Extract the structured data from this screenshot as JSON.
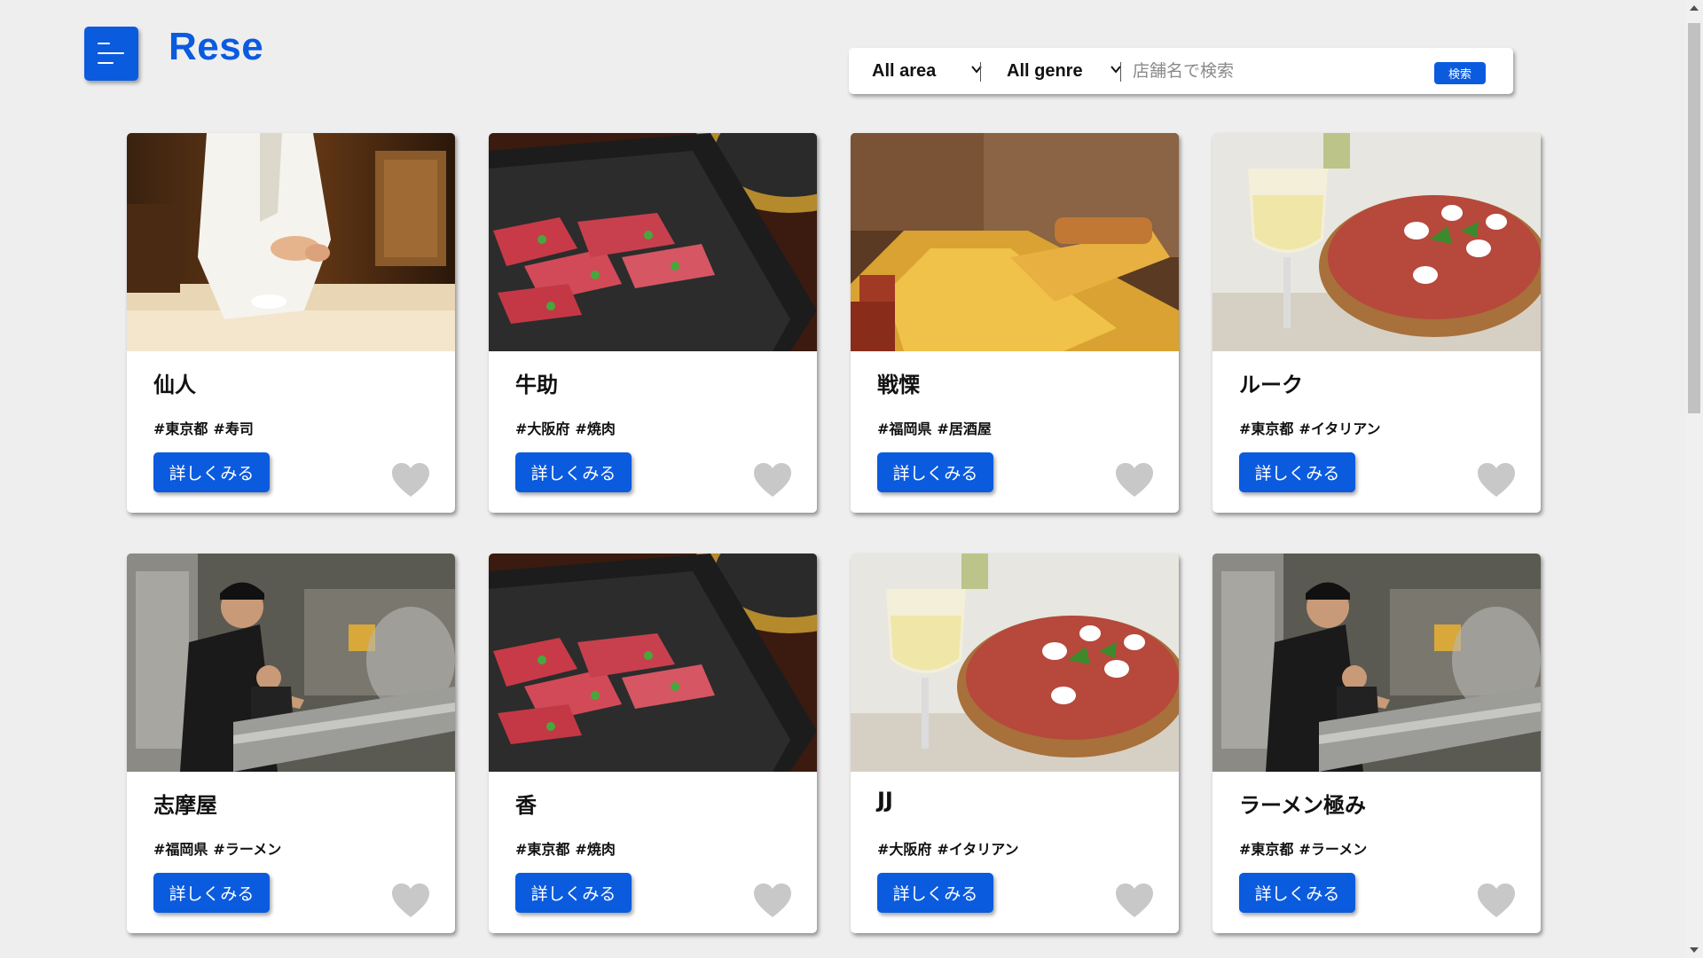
{
  "app": {
    "logo": "Rese",
    "brand_color": "#0b5bdf"
  },
  "menu": {
    "icon": "hamburger-menu-icon"
  },
  "search": {
    "area_selected": "All area",
    "genre_selected": "All genre",
    "placeholder": "店舗名で検索",
    "value": "",
    "button_label": "検索"
  },
  "shops": [
    {
      "name": "仙人",
      "area": "#東京都",
      "genre": "#寿司",
      "detail_label": "詳しくみる",
      "favorite": false,
      "image": "sushi"
    },
    {
      "name": "牛助",
      "area": "#大阪府",
      "genre": "#焼肉",
      "detail_label": "詳しくみる",
      "favorite": false,
      "image": "yakiniku"
    },
    {
      "name": "戦慄",
      "area": "#福岡県",
      "genre": "#居酒屋",
      "detail_label": "詳しくみる",
      "favorite": false,
      "image": "izakaya"
    },
    {
      "name": "ルーク",
      "area": "#東京都",
      "genre": "#イタリアン",
      "detail_label": "詳しくみる",
      "favorite": false,
      "image": "italian"
    },
    {
      "name": "志摩屋",
      "area": "#福岡県",
      "genre": "#ラーメン",
      "detail_label": "詳しくみる",
      "favorite": false,
      "image": "ramen"
    },
    {
      "name": "香",
      "area": "#東京都",
      "genre": "#焼肉",
      "detail_label": "詳しくみる",
      "favorite": false,
      "image": "yakiniku"
    },
    {
      "name": "JJ",
      "area": "#大阪府",
      "genre": "#イタリアン",
      "detail_label": "詳しくみる",
      "favorite": false,
      "image": "italian"
    },
    {
      "name": "ラーメン極み",
      "area": "#東京都",
      "genre": "#ラーメン",
      "detail_label": "詳しくみる",
      "favorite": false,
      "image": "ramen"
    }
  ]
}
